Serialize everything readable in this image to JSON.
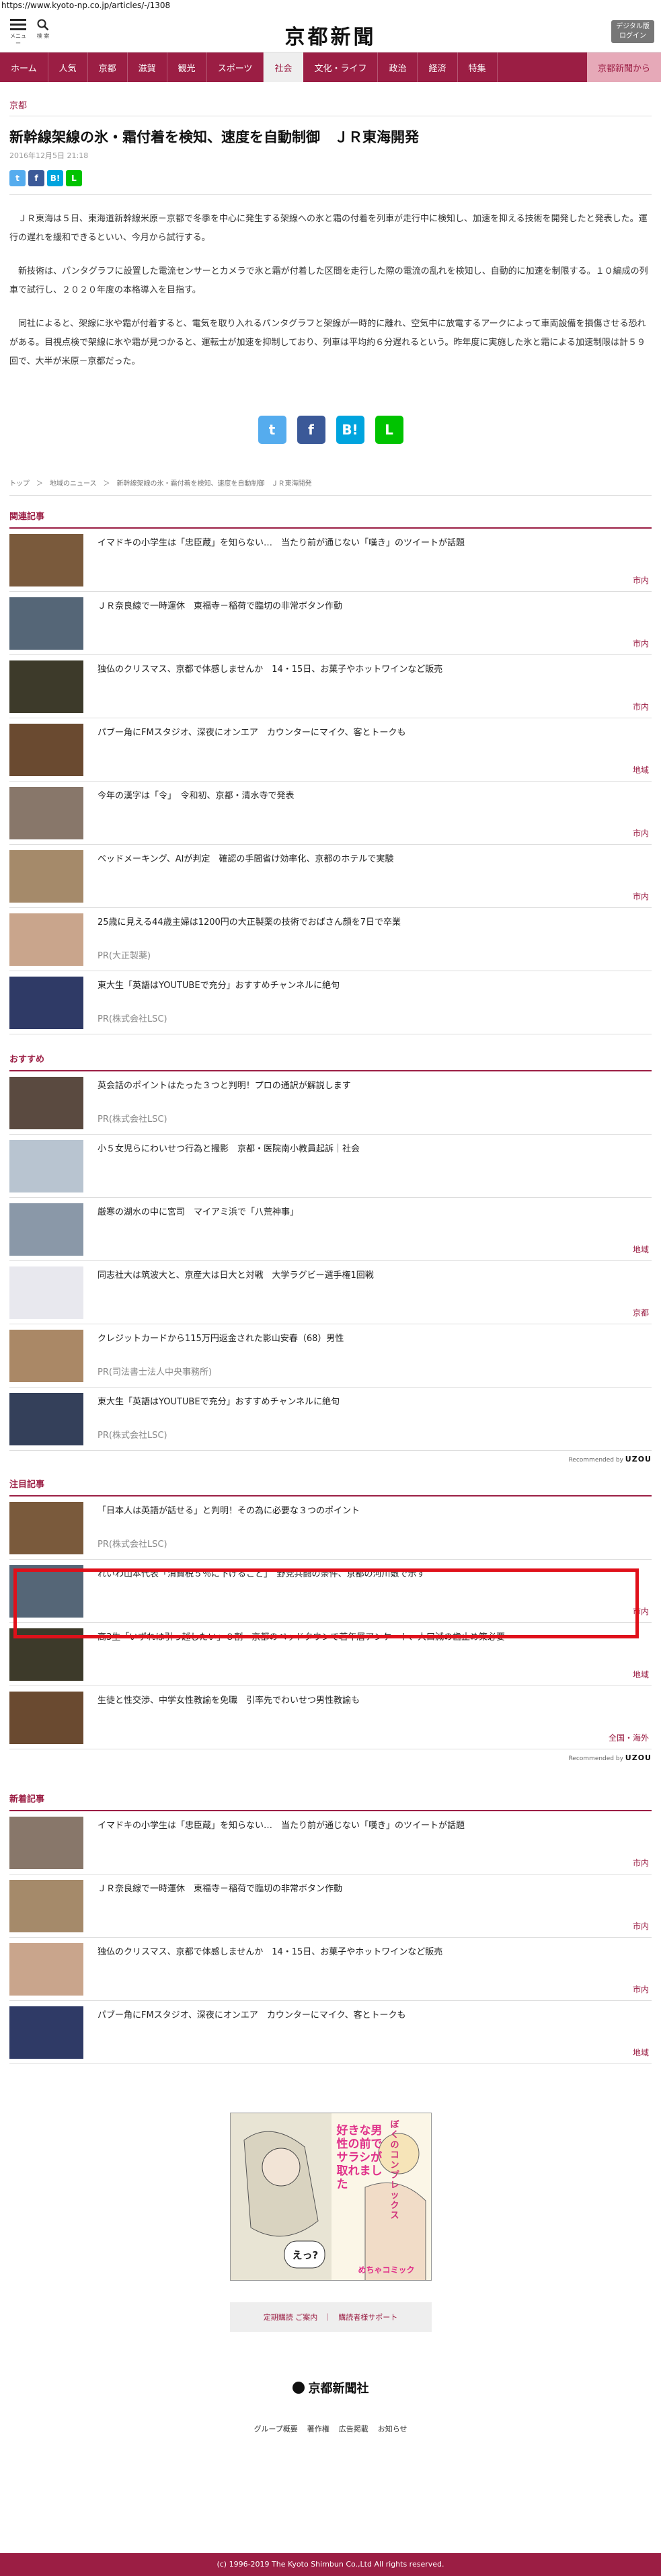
{
  "url": "https://www.kyoto-np.co.jp/articles/-/1308",
  "header": {
    "menu_caption": "メニュー",
    "search_caption": "検 索",
    "logo": "京都新聞",
    "digital_label": "デジタル版",
    "digital_login": "ログイン"
  },
  "nav": [
    "ホーム",
    "人気",
    "京都",
    "滋賀",
    "観光",
    "スポーツ",
    "社会",
    "文化・ライフ",
    "政治",
    "経済",
    "特集"
  ],
  "nav_right": "京都新聞から",
  "article": {
    "area": "京都",
    "title": "新幹線架線の氷・霜付着を検知、速度を自動制御　ＪＲ東海開発",
    "date": "2016年12月5日 21:18",
    "paras": [
      "　ＪＲ東海は５日、東海道新幹線米原－京都で冬季を中心に発生する架線への氷と霜の付着を列車が走行中に検知し、加速を抑える技術を開発したと発表した。運行の遅れを緩和できるといい、今月から試行する。",
      "　新技術は、パンタグラフに設置した電流センサーとカメラで氷と霜が付着した区間を走行した際の電流の乱れを検知し、自動的に加速を制限する。１０編成の列車で試行し、２０２０年度の本格導入を目指す。",
      "　同社によると、架線に氷や霜が付着すると、電気を取り入れるパンタグラフと架線が一時的に離れ、空気中に放電するアークによって車両設備を損傷させる恐れがある。目視点検で架線に氷や霜が見つかると、運転士が加速を抑制しており、列車は平均約６分遅れるという。昨年度に実施した氷と霜による加速制限は計５９回で、大半が米原－京都だった。"
    ]
  },
  "breadcrumb": [
    "トップ",
    "＞",
    "地域のニュース",
    "＞",
    "新幹線架線の氷・霜付着を検知、速度を自動制御　ＪＲ東海開発"
  ],
  "sections": {
    "related": {
      "title": "関連記事",
      "items": [
        {
          "title": "イマドキの小学生は「忠臣蔵」を知らない…　当たり前が通じない「嘆き」のツイートが話題",
          "meta": "市内",
          "pr": ""
        },
        {
          "title": "ＪＲ奈良線で一時運休　東福寺－稲荷で臨切の非常ボタン作動",
          "meta": "市内",
          "pr": ""
        },
        {
          "title": "独仏のクリスマス、京都で体感しませんか　14・15日、お菓子やホットワインなど販売",
          "meta": "市内",
          "pr": ""
        },
        {
          "title": "パブー角にFMスタジオ、深夜にオンエア　カウンターにマイク、客とトークも",
          "meta": "地域",
          "pr": ""
        },
        {
          "title": "今年の漢字は「令」　令和初、京都・清水寺で発表",
          "meta": "市内",
          "pr": ""
        },
        {
          "title": "ベッドメーキング、AIが判定　確認の手間省け効率化、京都のホテルで実験",
          "meta": "市内",
          "pr": ""
        },
        {
          "title": "25歳に見える44歳主婦は1200円の大正製薬の技術でおばさん顔を7日で卒業",
          "meta": "",
          "pr": "PR(大正製薬)"
        },
        {
          "title": "東大生「英語はYOUTUBEで充分」おすすめチャンネルに絶句",
          "meta": "",
          "pr": "PR(株式会社LSC)"
        }
      ]
    },
    "recommend": {
      "title": "おすすめ",
      "items": [
        {
          "title": "英会話のポイントはたった３つと判明！プロの通訳が解説します",
          "meta": "",
          "pr": "PR(株式会社LSC)"
        },
        {
          "title": "小５女児らにわいせつ行為と撮影　京都・医院南小教員起訴｜社会",
          "meta": "",
          "pr": ""
        },
        {
          "title": "厳寒の湖水の中に宮司　マイアミ浜で「八荒神事」",
          "meta": "地域",
          "pr": ""
        },
        {
          "title": "同志社大は筑波大と、京産大は日大と対戦　大学ラグビー選手権1回戦",
          "meta": "京都",
          "pr": ""
        },
        {
          "title": "クレジットカードから115万円返金された影山安春（68）男性",
          "meta": "",
          "pr": "PR(司法書士法人中央事務所)"
        },
        {
          "title": "東大生「英語はYOUTUBEで充分」おすすめチャンネルに絶句",
          "meta": "",
          "pr": "PR(株式会社LSC)"
        }
      ]
    },
    "attention": {
      "title": "注目記事",
      "items": [
        {
          "title": "「日本人は英語が話せる」と判明！その為に必要な３つのポイント",
          "meta": "",
          "pr": "PR(株式会社LSC)"
        },
        {
          "title": "れいわ山本代表「消費税５％に下げること」　野党共闘の条件、京都の河川敷で示す",
          "meta": "市内",
          "pr": ""
        },
        {
          "title": "高3生「いずれは引っ越したい」８割　京都のベッドタウンで若年層アンケート、人口減の歯止め策必要",
          "meta": "地域",
          "pr": ""
        },
        {
          "title": "生徒と性交渉、中学女性教諭を免職　引率先でわいせつ男性教諭も",
          "meta": "全国・海外",
          "pr": ""
        }
      ]
    },
    "latest": {
      "title": "新着記事",
      "items": [
        {
          "title": "イマドキの小学生は「忠臣蔵」を知らない…　当たり前が通じない「嘆き」のツイートが話題",
          "meta": "市内",
          "pr": ""
        },
        {
          "title": "ＪＲ奈良線で一時運休　東福寺－稲荷で臨切の非常ボタン作動",
          "meta": "市内",
          "pr": ""
        },
        {
          "title": "独仏のクリスマス、京都で体感しませんか　14・15日、お菓子やホットワインなど販売",
          "meta": "市内",
          "pr": ""
        },
        {
          "title": "パブー角にFMスタジオ、深夜にオンエア　カウンターにマイク、客とトークも",
          "meta": "地域",
          "pr": ""
        }
      ]
    }
  },
  "recommended_by": "Recommended by",
  "uzou": "UZOU",
  "ad": {
    "text1": "好きな男性の前でサラシが取れました",
    "text2": "ぼくのコンプレックス",
    "brand": "めちゃコミック",
    "bubble": "えっ?"
  },
  "footer": {
    "btn1": "定期購読 ご案内",
    "sep": "｜",
    "btn2": "購読者様サポート",
    "logo": "京都新聞社",
    "links": [
      "グループ概要",
      "著作権",
      "広告掲載",
      "お知らせ"
    ],
    "copyright": "(c) 1996-2019 The Kyoto Shimbun Co.,Ltd All rights reserved."
  },
  "colors": {
    "brand": "#9b1e44",
    "highlight": "#e0101a"
  }
}
